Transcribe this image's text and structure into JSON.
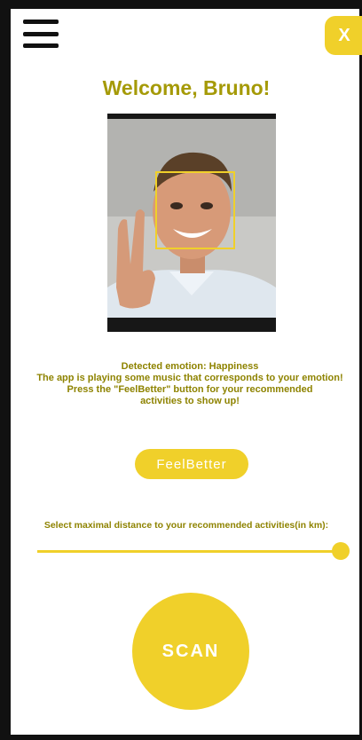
{
  "header": {
    "menu_icon": "hamburger-menu-icon",
    "close_label": "X"
  },
  "welcome": {
    "title": "Welcome, Bruno!"
  },
  "camera": {
    "image_name": "camera-preview-face",
    "face_frame_color": "#f0d02a"
  },
  "emotion": {
    "lines": [
      "Detected emotion: Happiness",
      "The app is playing some music that corresponds to your emotion!",
      "Press the \"FeelBetter\" button for your recommended",
      "activities to show up!"
    ]
  },
  "actions": {
    "feel_better_label": "FeelBetter",
    "scan_label": "SCAN"
  },
  "distance": {
    "label": "Select maximal distance to your recommended activities(in km):",
    "value_fraction": 1.0
  },
  "theme": {
    "accent": "#f0d02a",
    "title_color": "#a59a07",
    "text_color": "#8e8300"
  }
}
